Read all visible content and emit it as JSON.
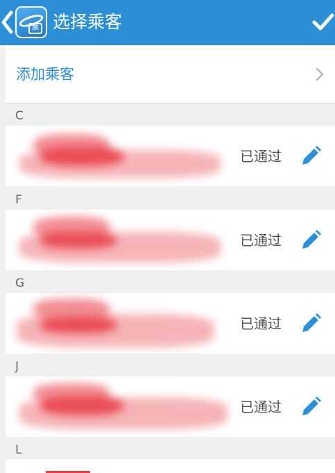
{
  "header": {
    "title": "选择乘客",
    "app_icon_glyph": "票",
    "back_icon": "chevron-left-icon",
    "confirm_icon": "checkmark-icon",
    "color": "#2d8fd5"
  },
  "add_passenger": {
    "label": "添加乘客",
    "icon": "chevron-right-icon",
    "color": "#2d8fd5"
  },
  "sections": [
    {
      "letter": "C",
      "passenger": {
        "status": "已通过",
        "name_redacted": true,
        "edit_icon": "pencil-icon"
      }
    },
    {
      "letter": "F",
      "passenger": {
        "status": "已通过",
        "name_redacted": true,
        "edit_icon": "pencil-icon"
      }
    },
    {
      "letter": "G",
      "passenger": {
        "status": "已通过",
        "name_redacted": true,
        "edit_icon": "pencil-icon"
      }
    },
    {
      "letter": "J",
      "passenger": {
        "status": "已通过",
        "name_redacted": true,
        "edit_icon": "pencil-icon"
      }
    },
    {
      "letter": "L"
    }
  ]
}
